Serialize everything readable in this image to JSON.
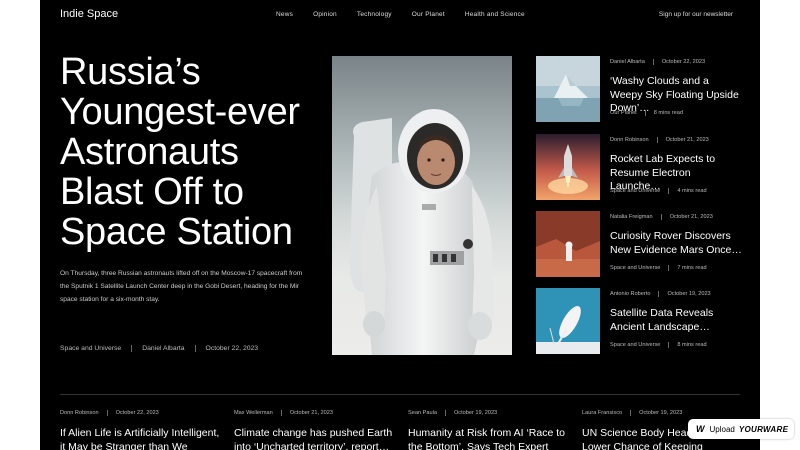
{
  "header": {
    "logo": "Indie Space",
    "nav": [
      "News",
      "Opinion",
      "Technology",
      "Our Planet",
      "Health and Science"
    ],
    "signup": "Sign up for our newsletter"
  },
  "hero": {
    "title": "Russia’s Youngest-ever Astronauts Blast Off to Space Station",
    "description": "On Thursday, three Russian astronauts lifted off on the Moscow-17 spacecraft from the Sputnik 1 Satellite Launch Center deep in the Gobi Desert, heading for the Mir space station for a six-month stay.",
    "category": "Space and Universe",
    "author": "Daniel Albarta",
    "date": "October 22, 2023"
  },
  "side_articles": [
    {
      "author": "Daniel Albarta",
      "date": "October 22, 2023",
      "title": "‘Washy Clouds and a Weepy Sky Floating Upside Down’…",
      "category": "Our Planet",
      "read": "8 mins read"
    },
    {
      "author": "Donn Robinson",
      "date": "October 21, 2023",
      "title": "Rocket Lab Expects to Resume Electron Launche…",
      "category": "Space and Universe",
      "read": "4 mins read"
    },
    {
      "author": "Natalia Freigman",
      "date": "October 21, 2023",
      "title": "Curiosity Rover Discovers New Evidence Mars Once…",
      "category": "Space and Universe",
      "read": "7 mins read"
    },
    {
      "author": "Antonio Roberto",
      "date": "October 19, 2023",
      "title": "Satellite Data Reveals Ancient Landscape…",
      "category": "Space and Universe",
      "read": "8 mins read"
    }
  ],
  "bottom_articles": [
    {
      "author": "Donn Robinson",
      "date": "October 22, 2023",
      "title": "If Alien Life is Artificially Intelligent, it May be Stranger than We Can…"
    },
    {
      "author": "Max Wellerman",
      "date": "October 21, 2023",
      "title": "Climate change has pushed Earth into ‘Uncharted territory’, report…"
    },
    {
      "author": "Sean Paula",
      "date": "October 19, 2023",
      "title": "Humanity at Risk from AI ‘Race to the Bottom’, Says Tech Expert"
    },
    {
      "author": "Laura Fransisco",
      "date": "October 19, 2023",
      "title": "UN Science Body Head Fears Lower Chance of Keeping Global…"
    }
  ],
  "badge": {
    "icon_letter": "W",
    "label": "Upload",
    "brand": "YOURWARE"
  }
}
